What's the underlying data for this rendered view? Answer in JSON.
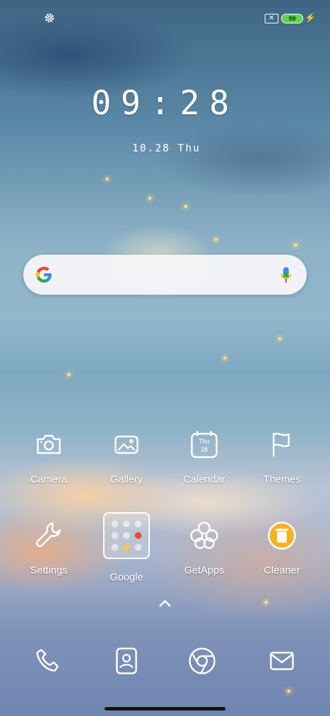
{
  "status_bar": {
    "settings_icon": "gear-icon",
    "sim_icon": "no-sim-icon",
    "battery_level": "99",
    "battery_color": "#5dd24e",
    "charging_icon": "bolt-icon"
  },
  "clock": {
    "time": "09:28",
    "date": "10.28 Thu"
  },
  "search_bar": {
    "logo": "google-g-icon",
    "mic": "mic-icon"
  },
  "apps": [
    {
      "label": "Camera",
      "icon": "camera-icon"
    },
    {
      "label": "Gallery",
      "icon": "gallery-icon"
    },
    {
      "label": "Calendar",
      "icon": "calendar-icon",
      "day": "Thu",
      "date": "28"
    },
    {
      "label": "Themes",
      "icon": "flag-icon"
    },
    {
      "label": "Settings",
      "icon": "wrench-icon"
    },
    {
      "label": "Google",
      "icon": "folder-icon"
    },
    {
      "label": "GetApps",
      "icon": "flower-icon"
    },
    {
      "label": "Cleaner",
      "icon": "trash-icon",
      "accent": "#f5b324"
    }
  ],
  "dock": [
    {
      "icon": "phone-icon"
    },
    {
      "icon": "contacts-icon"
    },
    {
      "icon": "chrome-icon"
    },
    {
      "icon": "mail-icon"
    }
  ],
  "app_drawer_hint": "chevron-up-icon"
}
